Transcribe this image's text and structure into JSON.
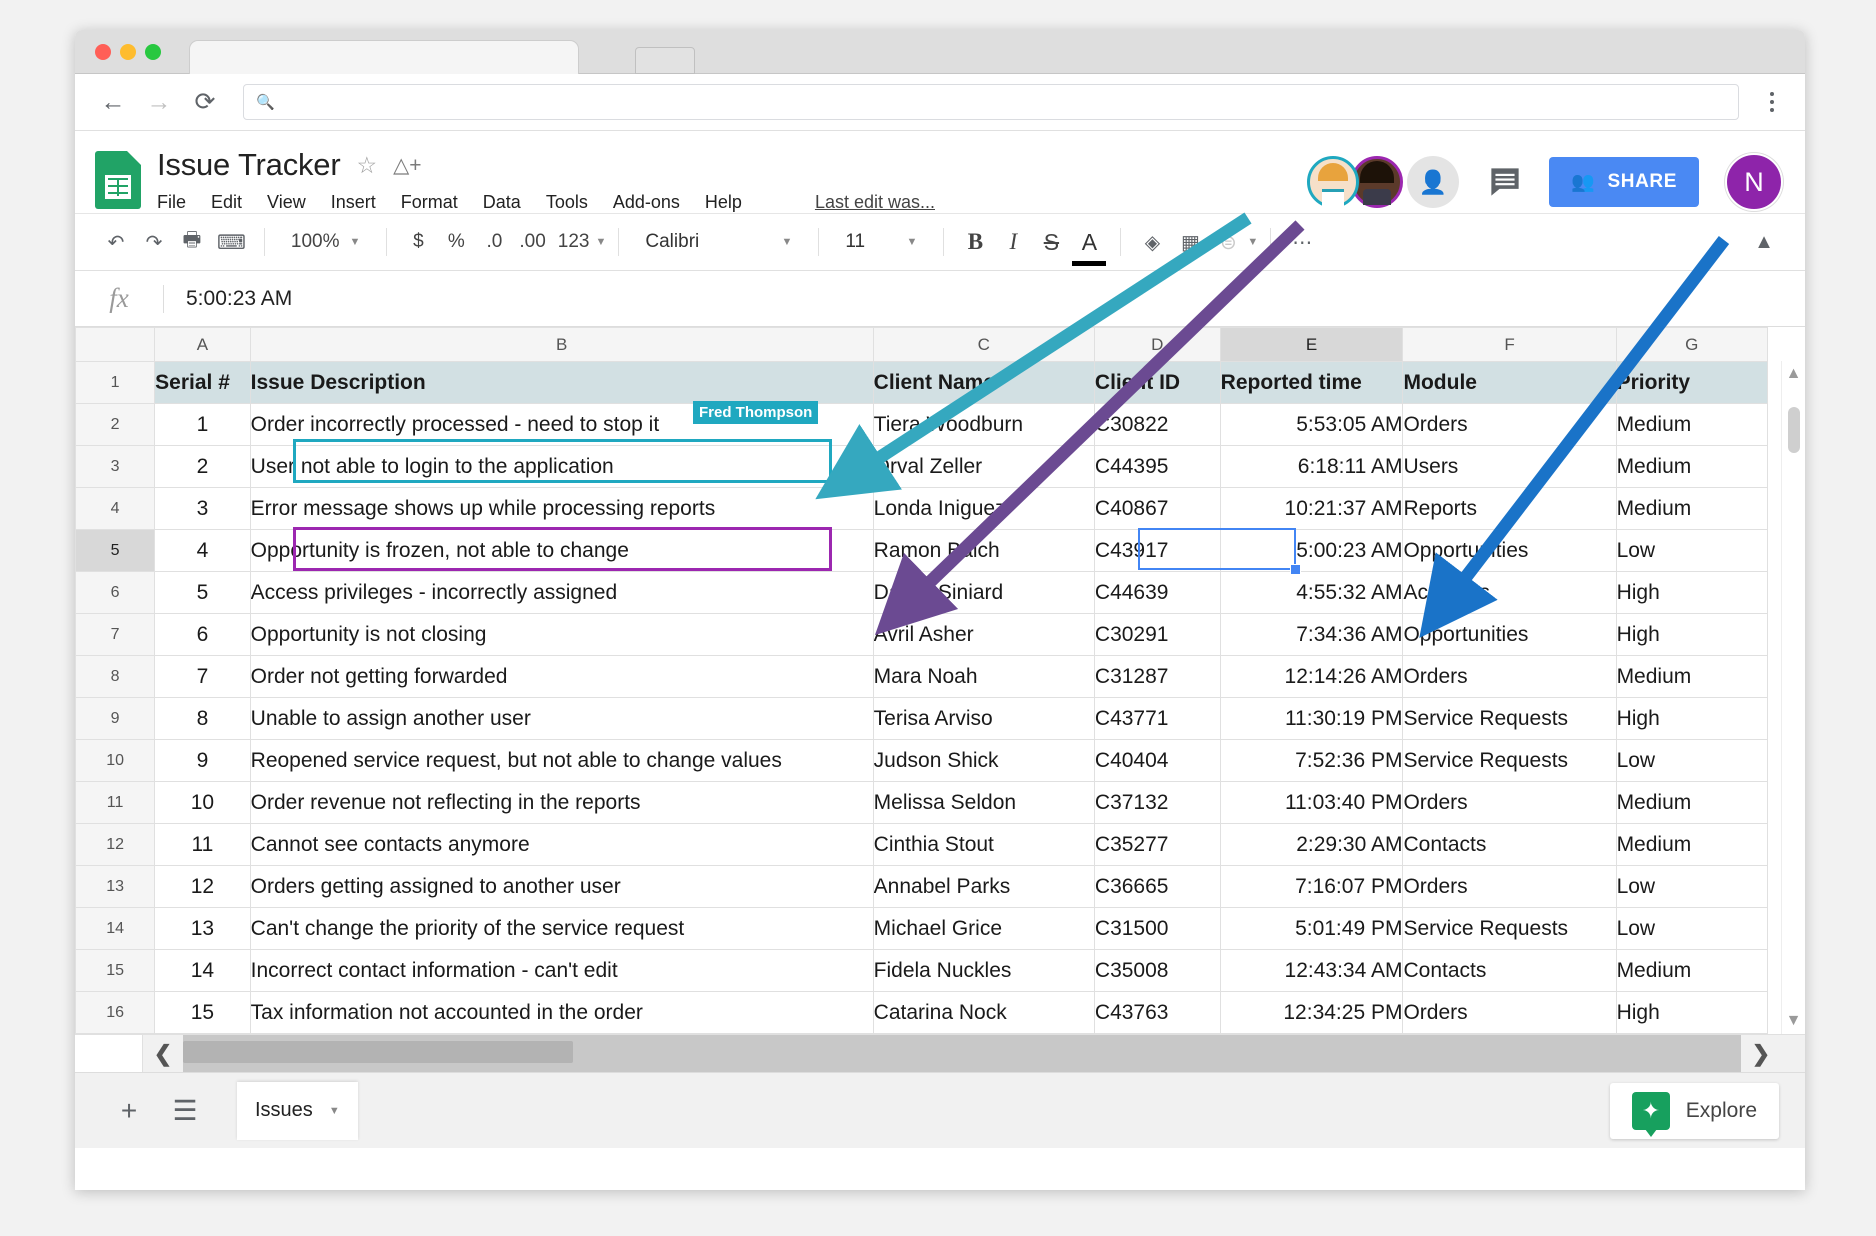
{
  "browser": {
    "back_icon": "back-arrow-icon",
    "forward_icon": "forward-arrow-icon",
    "reload_icon": "reload-icon",
    "omnibox_placeholder": "",
    "omnibox_value": "",
    "search_icon": "search-icon",
    "menu_icon": "kebab-menu-icon"
  },
  "doc": {
    "title": "Issue Tracker",
    "star_icon": "star-icon",
    "drive_icon": "move-to-drive-icon",
    "last_edit": "Last edit was...",
    "menu": [
      "File",
      "Edit",
      "View",
      "Insert",
      "Format",
      "Data",
      "Tools",
      "Add-ons",
      "Help"
    ]
  },
  "header_right": {
    "collaborator_1": "collaborator-avatar-blond",
    "collaborator_2": "collaborator-avatar-dark",
    "anonymous_icon": "anonymous-user-icon",
    "comments_icon": "comments-icon",
    "share_label": "SHARE",
    "share_icon": "share-person-icon",
    "account_initial": "N",
    "accent_share": "#4a89f3",
    "accent_account": "#8e24aa"
  },
  "toolbar": {
    "undo": "undo-icon",
    "redo": "redo-icon",
    "print": "print-icon",
    "paint": "paint-format-icon",
    "zoom_value": "100%",
    "currency": "$",
    "percent": "%",
    "decimal_decrease": ".0",
    "decimal_increase": ".00",
    "number_format": "123",
    "font_name": "Calibri",
    "font_size": "11",
    "bold": "B",
    "italic": "I",
    "strikethrough": "S",
    "text_color": "A",
    "fill_color": "fill-color-icon",
    "borders": "borders-icon",
    "merge": "merge-cells-icon",
    "more": "more-options-icon",
    "collapse": "collapse-toolbar-icon"
  },
  "formula_bar": {
    "fx_label": "fx",
    "value": "5:00:23 AM"
  },
  "grid": {
    "columns": [
      "A",
      "B",
      "C",
      "D",
      "E",
      "F",
      "G"
    ],
    "active_column": "E",
    "active_row": "5",
    "active_cell_value": "5:00:23 AM",
    "collaborator_flag": "Fred Thompson",
    "headers": [
      "Serial #",
      "Issue Description",
      "Client Name",
      "Client ID",
      "Reported time",
      "Module",
      "Priority"
    ],
    "rows": [
      {
        "n": "2",
        "serial": "1",
        "desc": "Order incorrectly processed - need to stop it",
        "client": "Tiera Woodburn",
        "id": "C30822",
        "time": "5:53:05 AM",
        "module": "Orders",
        "priority": "Medium"
      },
      {
        "n": "3",
        "serial": "2",
        "desc": "User not able to login to the application",
        "client": "Orval Zeller",
        "id": "C44395",
        "time": "6:18:11 AM",
        "module": "Users",
        "priority": "Medium"
      },
      {
        "n": "4",
        "serial": "3",
        "desc": "Error message shows up while processing reports",
        "client": "Londa Iniguez",
        "id": "C40867",
        "time": "10:21:37 AM",
        "module": "Reports",
        "priority": "Medium"
      },
      {
        "n": "5",
        "serial": "4",
        "desc": "Opportunity is frozen, not able to change",
        "client": "Ramon Balch",
        "id": "C43917",
        "time": "5:00:23 AM",
        "module": "Opportunities",
        "priority": "Low"
      },
      {
        "n": "6",
        "serial": "5",
        "desc": "Access privileges - incorrectly assigned",
        "client": "Dallas Siniard",
        "id": "C44639",
        "time": "4:55:32 AM",
        "module": "Accounts",
        "priority": "High"
      },
      {
        "n": "7",
        "serial": "6",
        "desc": "Opportunity is not closing",
        "client": "Avril Asher",
        "id": "C30291",
        "time": "7:34:36 AM",
        "module": "Opportunities",
        "priority": "High"
      },
      {
        "n": "8",
        "serial": "7",
        "desc": "Order not getting forwarded",
        "client": "Mara Noah",
        "id": "C31287",
        "time": "12:14:26 AM",
        "module": "Orders",
        "priority": "Medium"
      },
      {
        "n": "9",
        "serial": "8",
        "desc": "Unable to assign another user",
        "client": "Terisa Arviso",
        "id": "C43771",
        "time": "11:30:19 PM",
        "module": "Service Requests",
        "priority": "High"
      },
      {
        "n": "10",
        "serial": "9",
        "desc": "Reopened service request, but not able to change values",
        "client": "Judson Shick",
        "id": "C40404",
        "time": "7:52:36 PM",
        "module": "Service Requests",
        "priority": "Low"
      },
      {
        "n": "11",
        "serial": "10",
        "desc": "Order revenue not reflecting in the reports",
        "client": "Melissa Seldon",
        "id": "C37132",
        "time": "11:03:40 PM",
        "module": "Orders",
        "priority": "Medium"
      },
      {
        "n": "12",
        "serial": "11",
        "desc": "Cannot see contacts anymore",
        "client": "Cinthia Stout",
        "id": "C35277",
        "time": "2:29:30 AM",
        "module": "Contacts",
        "priority": "Medium"
      },
      {
        "n": "13",
        "serial": "12",
        "desc": "Orders getting assigned to another user",
        "client": "Annabel Parks",
        "id": "C36665",
        "time": "7:16:07 PM",
        "module": "Orders",
        "priority": "Low"
      },
      {
        "n": "14",
        "serial": "13",
        "desc": "Can't change the priority of the service request",
        "client": "Michael Grice",
        "id": "C31500",
        "time": "5:01:49 PM",
        "module": "Service Requests",
        "priority": "Low"
      },
      {
        "n": "15",
        "serial": "14",
        "desc": "Incorrect contact information - can't edit",
        "client": "Fidela Nuckles",
        "id": "C35008",
        "time": "12:43:34 AM",
        "module": "Contacts",
        "priority": "Medium"
      },
      {
        "n": "16",
        "serial": "15",
        "desc": "Tax information not accounted in the order",
        "client": "Catarina Nock",
        "id": "C43763",
        "time": "12:34:25 PM",
        "module": "Orders",
        "priority": "High"
      }
    ]
  },
  "bottom": {
    "add_sheet_icon": "add-sheet-icon",
    "all_sheets_icon": "all-sheets-icon",
    "sheet_tab_name": "Issues",
    "sheet_tab_caret": "chevron-down-icon",
    "explore_label": "Explore",
    "explore_icon": "explore-star-icon"
  },
  "annotations": {
    "arrow_teal_color": "#35a8bf",
    "arrow_purple_color": "#6b4a92",
    "arrow_blue_color": "#1a73c8"
  }
}
